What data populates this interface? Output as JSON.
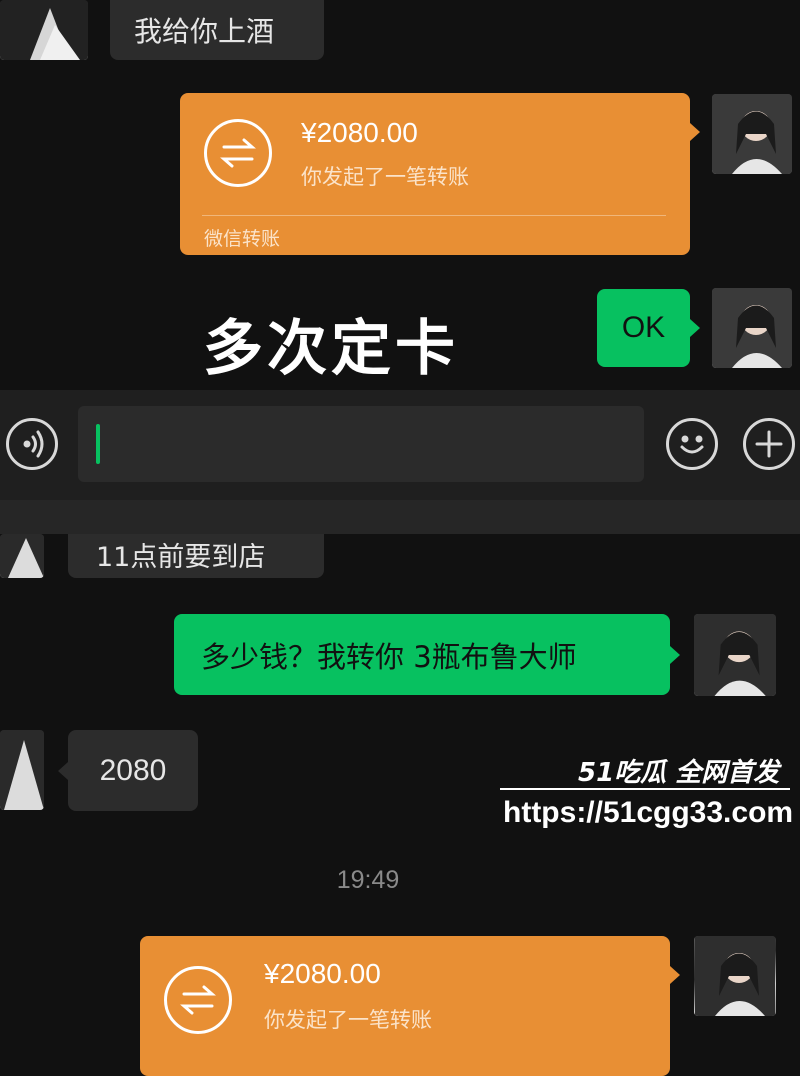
{
  "messages": {
    "top_greeting": "我给你上酒",
    "transfer_amount": "¥2080.00",
    "transfer_desc": "你发起了一笔转账",
    "transfer_footer": "微信转账",
    "ok_reply": "OK",
    "partial_line": "11点前要到店",
    "green_question": "多少钱？我转你 3瓶布鲁大师",
    "price_reply": "2080",
    "timestamp": "19:49"
  },
  "overlay": {
    "caption": "多次定卡",
    "watermark_brand": "51吃瓜 全网首发",
    "watermark_url": "https://51cgg33.com"
  },
  "colors": {
    "background": "#111111",
    "green_bubble": "#07c160",
    "transfer_orange": "#e88f34",
    "gray_bubble": "#2c2c2c",
    "cursor": "#07c160"
  },
  "icons": [
    "voice-icon",
    "emoji-icon",
    "plus-icon",
    "transfer-arrows-icon"
  ]
}
